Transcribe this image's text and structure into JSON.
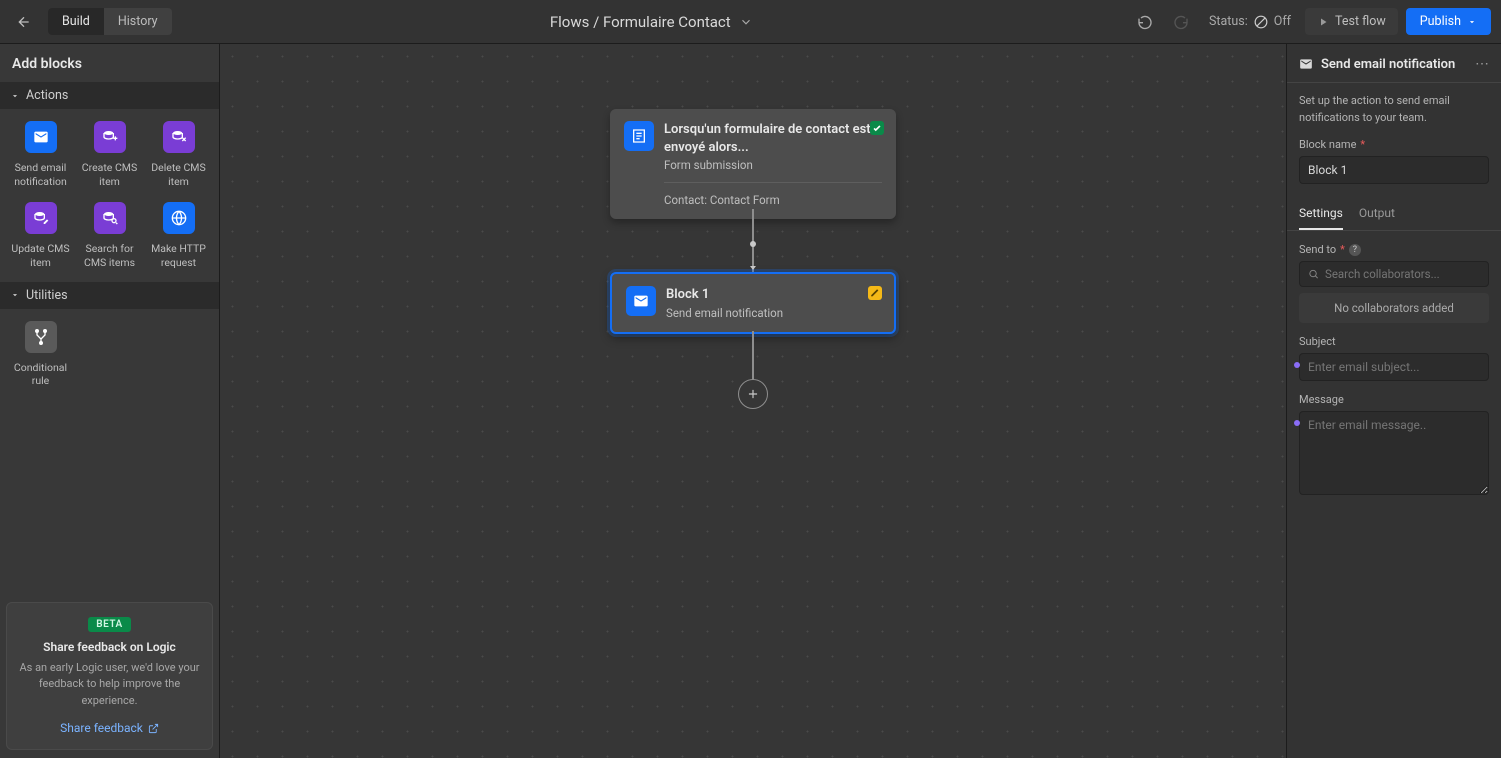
{
  "topbar": {
    "tab_build": "Build",
    "tab_history": "History",
    "breadcrumb": "Flows / Formulaire Contact",
    "status_label": "Status:",
    "status_value": "Off",
    "test_flow": "Test flow",
    "publish": "Publish"
  },
  "sidebar": {
    "title": "Add blocks",
    "section_actions": "Actions",
    "section_utilities": "Utilities",
    "blocks": {
      "send_email": "Send email notification",
      "create_cms": "Create CMS item",
      "delete_cms": "Delete CMS item",
      "update_cms": "Update CMS item",
      "search_cms": "Search for CMS items",
      "http": "Make HTTP request",
      "conditional": "Conditional rule"
    }
  },
  "feedback": {
    "beta": "BETA",
    "title": "Share feedback on Logic",
    "desc": "As an early Logic user, we'd love your feedback to help improve the experience.",
    "link": "Share feedback"
  },
  "canvas": {
    "trigger": {
      "title": "Lorsqu'un formulaire de contact est envoyé alors...",
      "subtitle": "Form submission",
      "detail": "Contact: Contact Form"
    },
    "block1": {
      "title": "Block 1",
      "subtitle": "Send email notification"
    }
  },
  "inspector": {
    "header": "Send email notification",
    "desc": "Set up the action to send email notifications to your team.",
    "block_name_label": "Block name",
    "block_name_value": "Block 1",
    "tab_settings": "Settings",
    "tab_output": "Output",
    "send_to_label": "Send to",
    "send_to_placeholder": "Search collaborators...",
    "no_collab": "No collaborators added",
    "subject_label": "Subject",
    "subject_placeholder": "Enter email subject...",
    "message_label": "Message",
    "message_placeholder": "Enter email message.."
  }
}
